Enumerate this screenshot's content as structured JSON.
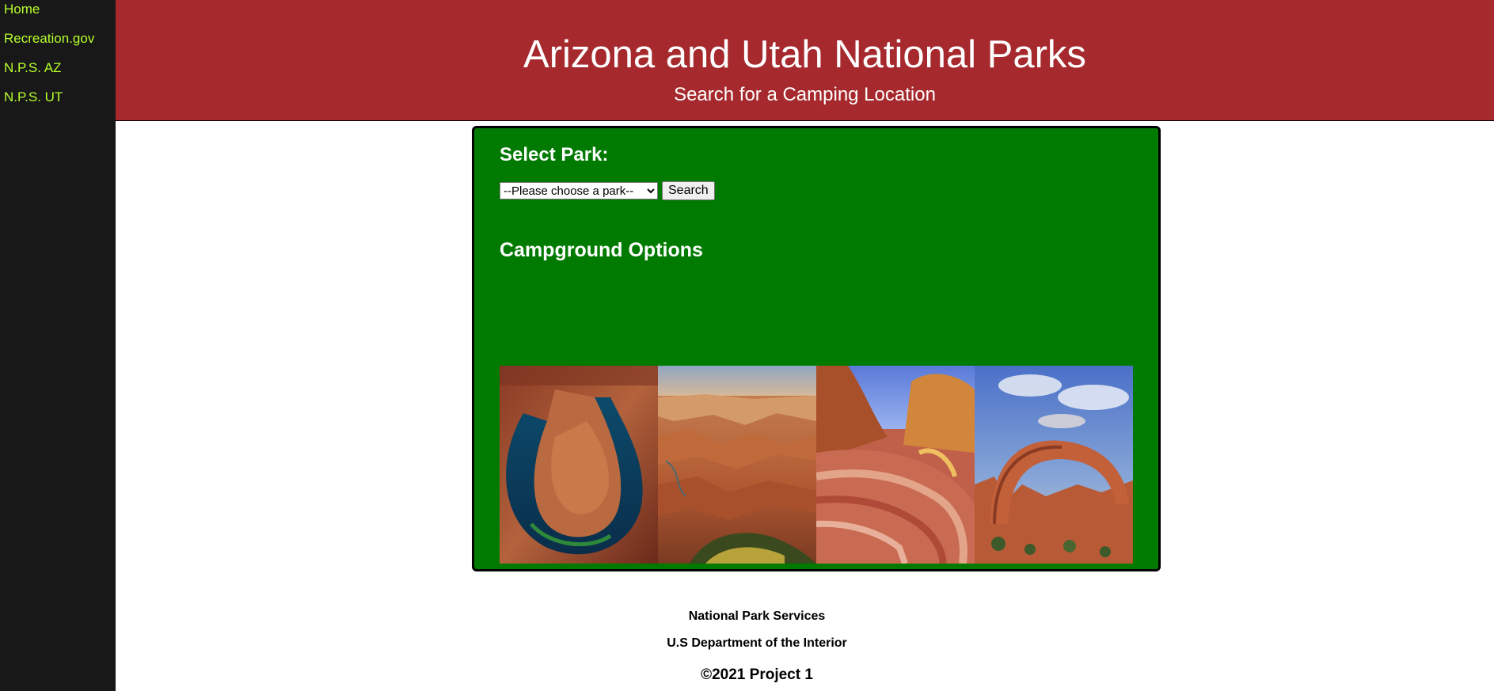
{
  "nav": {
    "items": [
      {
        "label": "Home"
      },
      {
        "label": "Recreation.gov"
      },
      {
        "label": "N.P.S. AZ"
      },
      {
        "label": "N.P.S. UT"
      }
    ]
  },
  "header": {
    "title": "Arizona and Utah National Parks",
    "subtitle": "Search for a Camping Location"
  },
  "search": {
    "heading": "Select Park:",
    "select_value": "--Please choose a park--",
    "button_label": "Search"
  },
  "campground": {
    "heading": "Campground Options"
  },
  "gallery": {
    "photos": [
      {
        "name": "horseshoe-bend-photo"
      },
      {
        "name": "grand-canyon-photo"
      },
      {
        "name": "the-wave-photo"
      },
      {
        "name": "natural-arch-photo"
      }
    ]
  },
  "footer": {
    "line1": "National Park Services",
    "line2": "U.S Department of the Interior",
    "copyright": "©2021 Project 1"
  },
  "colors": {
    "sidebar_bg": "#181818",
    "nav_link": "#b8ff2c",
    "header_bg": "#a6292d",
    "panel_bg": "#007a00"
  }
}
